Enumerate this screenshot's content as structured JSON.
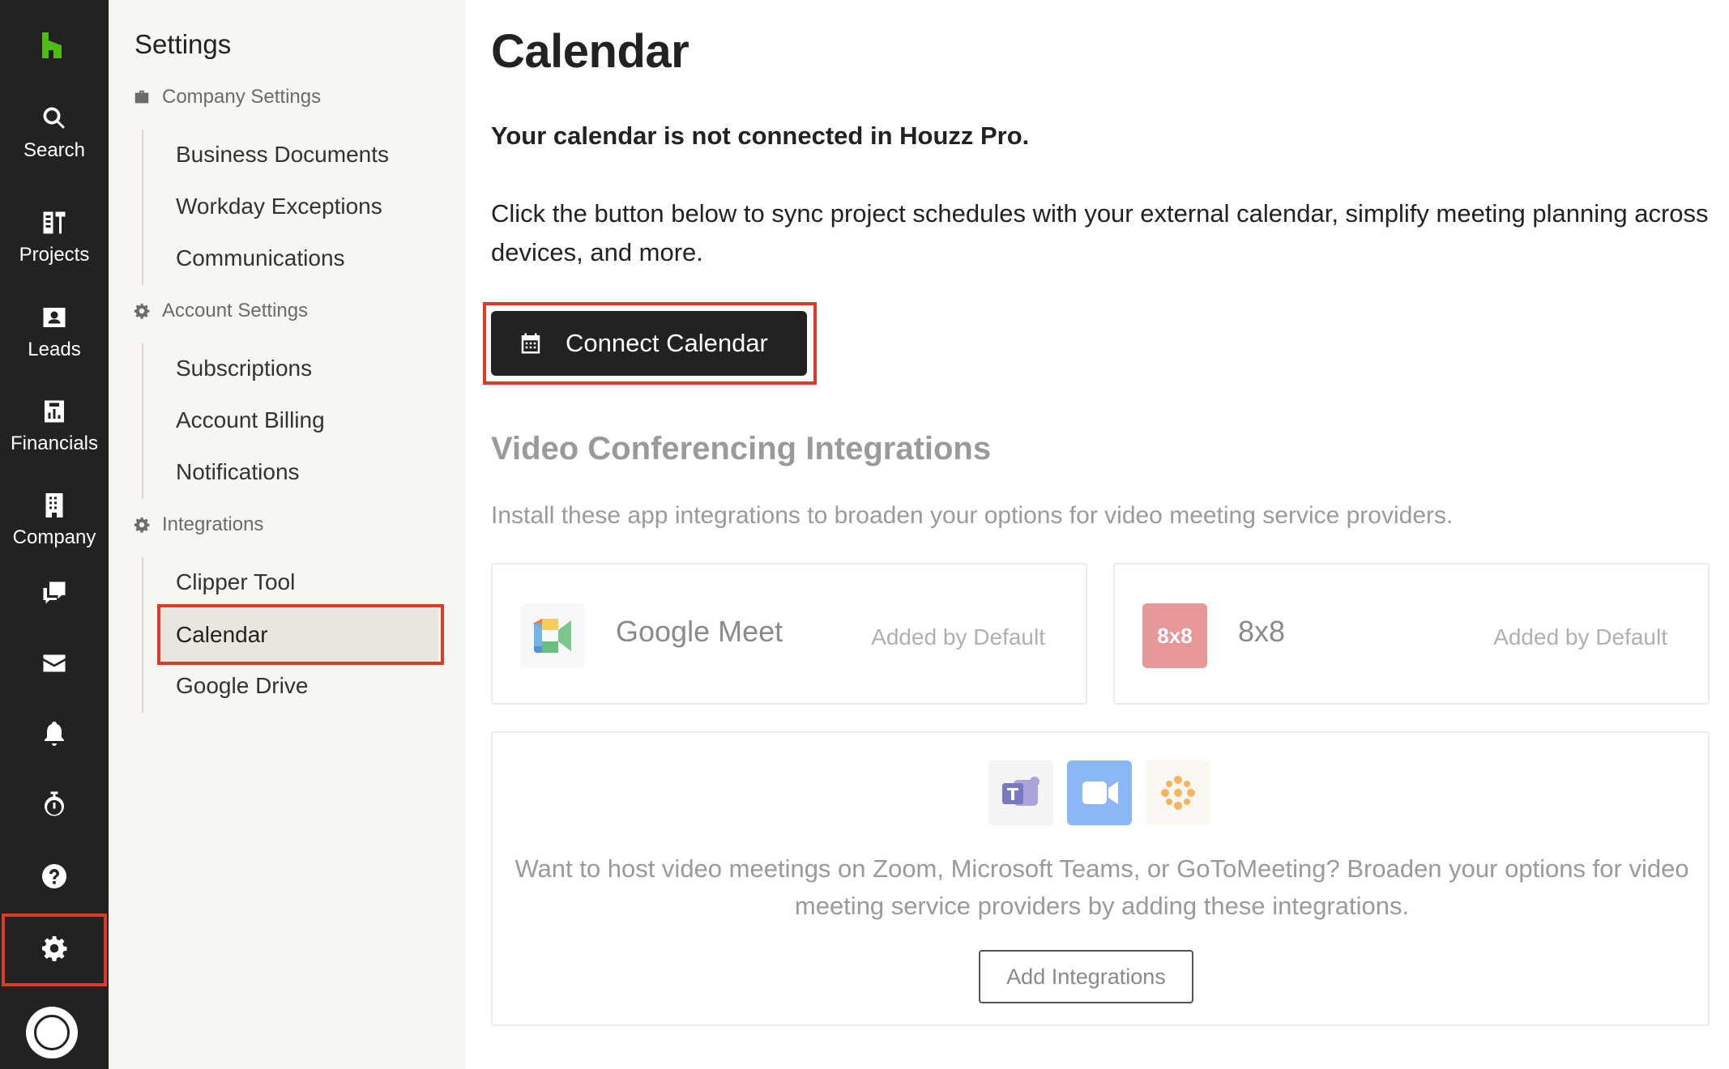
{
  "rail": {
    "items": [
      {
        "label": "Search",
        "icon": "search-icon"
      },
      {
        "label": "Projects",
        "icon": "projects-icon"
      },
      {
        "label": "Leads",
        "icon": "leads-icon"
      },
      {
        "label": "Financials",
        "icon": "financials-icon"
      },
      {
        "label": "Company",
        "icon": "company-icon"
      }
    ],
    "icons_only": [
      "chat-icon",
      "inbox-icon",
      "bell-icon",
      "timer-icon",
      "help-icon",
      "gear-icon"
    ],
    "brand_color": "#4dbc15"
  },
  "sidebar": {
    "title": "Settings",
    "groups": [
      {
        "label": "Company Settings",
        "icon": "briefcase-icon",
        "items": [
          "Business Documents",
          "Workday Exceptions",
          "Communications"
        ]
      },
      {
        "label": "Account Settings",
        "icon": "gear-icon",
        "items": [
          "Subscriptions",
          "Account Billing",
          "Notifications"
        ]
      },
      {
        "label": "Integrations",
        "icon": "gear-icon",
        "items": [
          "Clipper Tool",
          "Calendar",
          "Google Drive"
        ]
      }
    ],
    "active_item": "Calendar"
  },
  "main": {
    "title": "Calendar",
    "status": "Your calendar is not connected in Houzz Pro.",
    "description": "Click the button below to sync project schedules with your external calendar, simplify meeting planning across devices, and more.",
    "connect_button": "Connect Calendar",
    "video_heading": "Video Conferencing Integrations",
    "video_sub": "Install these app integrations to broaden your options for video meeting service providers.",
    "integrations": [
      {
        "name": "Google Meet",
        "status": "Added by Default",
        "icon": "google-meet-icon"
      },
      {
        "name": "8x8",
        "status": "Added by Default",
        "icon": "8x8-logo",
        "logo_text": "8x8"
      }
    ],
    "more": {
      "icons": [
        "teams-icon",
        "zoom-icon",
        "gotomeeting-icon"
      ],
      "text": "Want to host video meetings on Zoom, Microsoft Teams, or GoToMeeting? Broaden your options for video meeting service providers by adding these integrations.",
      "button": "Add Integrations"
    }
  },
  "highlight_color": "#e03a26"
}
